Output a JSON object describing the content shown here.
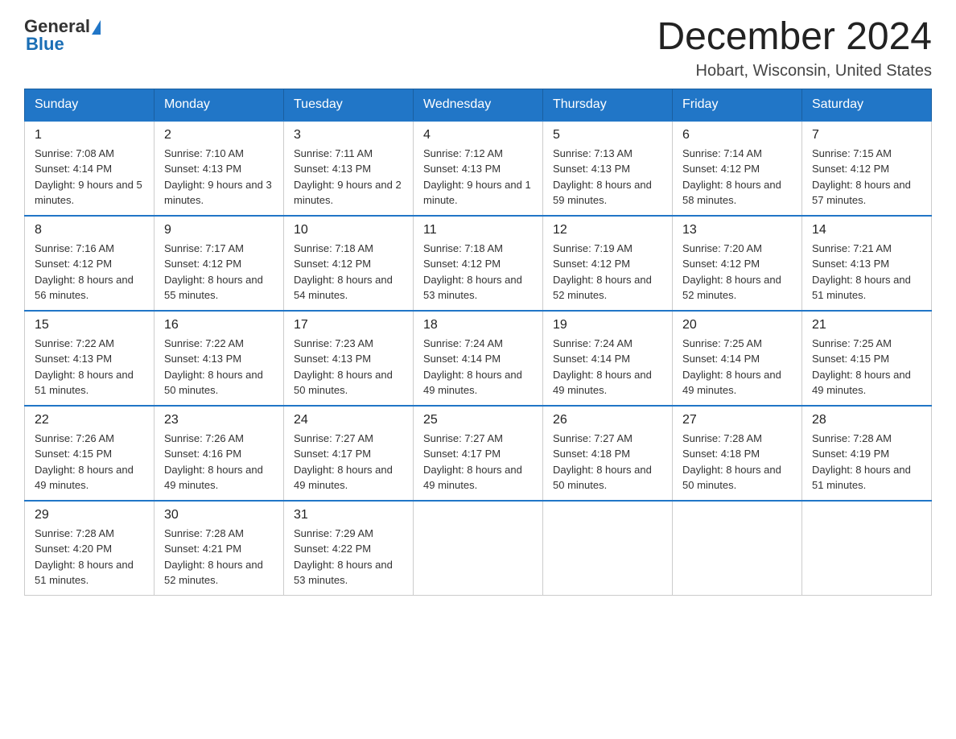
{
  "header": {
    "logo_general": "General",
    "logo_blue": "Blue",
    "month_title": "December 2024",
    "location": "Hobart, Wisconsin, United States"
  },
  "days_of_week": [
    "Sunday",
    "Monday",
    "Tuesday",
    "Wednesday",
    "Thursday",
    "Friday",
    "Saturday"
  ],
  "weeks": [
    [
      {
        "day": "1",
        "sunrise": "7:08 AM",
        "sunset": "4:14 PM",
        "daylight": "9 hours and 5 minutes."
      },
      {
        "day": "2",
        "sunrise": "7:10 AM",
        "sunset": "4:13 PM",
        "daylight": "9 hours and 3 minutes."
      },
      {
        "day": "3",
        "sunrise": "7:11 AM",
        "sunset": "4:13 PM",
        "daylight": "9 hours and 2 minutes."
      },
      {
        "day": "4",
        "sunrise": "7:12 AM",
        "sunset": "4:13 PM",
        "daylight": "9 hours and 1 minute."
      },
      {
        "day": "5",
        "sunrise": "7:13 AM",
        "sunset": "4:13 PM",
        "daylight": "8 hours and 59 minutes."
      },
      {
        "day": "6",
        "sunrise": "7:14 AM",
        "sunset": "4:12 PM",
        "daylight": "8 hours and 58 minutes."
      },
      {
        "day": "7",
        "sunrise": "7:15 AM",
        "sunset": "4:12 PM",
        "daylight": "8 hours and 57 minutes."
      }
    ],
    [
      {
        "day": "8",
        "sunrise": "7:16 AM",
        "sunset": "4:12 PM",
        "daylight": "8 hours and 56 minutes."
      },
      {
        "day": "9",
        "sunrise": "7:17 AM",
        "sunset": "4:12 PM",
        "daylight": "8 hours and 55 minutes."
      },
      {
        "day": "10",
        "sunrise": "7:18 AM",
        "sunset": "4:12 PM",
        "daylight": "8 hours and 54 minutes."
      },
      {
        "day": "11",
        "sunrise": "7:18 AM",
        "sunset": "4:12 PM",
        "daylight": "8 hours and 53 minutes."
      },
      {
        "day": "12",
        "sunrise": "7:19 AM",
        "sunset": "4:12 PM",
        "daylight": "8 hours and 52 minutes."
      },
      {
        "day": "13",
        "sunrise": "7:20 AM",
        "sunset": "4:12 PM",
        "daylight": "8 hours and 52 minutes."
      },
      {
        "day": "14",
        "sunrise": "7:21 AM",
        "sunset": "4:13 PM",
        "daylight": "8 hours and 51 minutes."
      }
    ],
    [
      {
        "day": "15",
        "sunrise": "7:22 AM",
        "sunset": "4:13 PM",
        "daylight": "8 hours and 51 minutes."
      },
      {
        "day": "16",
        "sunrise": "7:22 AM",
        "sunset": "4:13 PM",
        "daylight": "8 hours and 50 minutes."
      },
      {
        "day": "17",
        "sunrise": "7:23 AM",
        "sunset": "4:13 PM",
        "daylight": "8 hours and 50 minutes."
      },
      {
        "day": "18",
        "sunrise": "7:24 AM",
        "sunset": "4:14 PM",
        "daylight": "8 hours and 49 minutes."
      },
      {
        "day": "19",
        "sunrise": "7:24 AM",
        "sunset": "4:14 PM",
        "daylight": "8 hours and 49 minutes."
      },
      {
        "day": "20",
        "sunrise": "7:25 AM",
        "sunset": "4:14 PM",
        "daylight": "8 hours and 49 minutes."
      },
      {
        "day": "21",
        "sunrise": "7:25 AM",
        "sunset": "4:15 PM",
        "daylight": "8 hours and 49 minutes."
      }
    ],
    [
      {
        "day": "22",
        "sunrise": "7:26 AM",
        "sunset": "4:15 PM",
        "daylight": "8 hours and 49 minutes."
      },
      {
        "day": "23",
        "sunrise": "7:26 AM",
        "sunset": "4:16 PM",
        "daylight": "8 hours and 49 minutes."
      },
      {
        "day": "24",
        "sunrise": "7:27 AM",
        "sunset": "4:17 PM",
        "daylight": "8 hours and 49 minutes."
      },
      {
        "day": "25",
        "sunrise": "7:27 AM",
        "sunset": "4:17 PM",
        "daylight": "8 hours and 49 minutes."
      },
      {
        "day": "26",
        "sunrise": "7:27 AM",
        "sunset": "4:18 PM",
        "daylight": "8 hours and 50 minutes."
      },
      {
        "day": "27",
        "sunrise": "7:28 AM",
        "sunset": "4:18 PM",
        "daylight": "8 hours and 50 minutes."
      },
      {
        "day": "28",
        "sunrise": "7:28 AM",
        "sunset": "4:19 PM",
        "daylight": "8 hours and 51 minutes."
      }
    ],
    [
      {
        "day": "29",
        "sunrise": "7:28 AM",
        "sunset": "4:20 PM",
        "daylight": "8 hours and 51 minutes."
      },
      {
        "day": "30",
        "sunrise": "7:28 AM",
        "sunset": "4:21 PM",
        "daylight": "8 hours and 52 minutes."
      },
      {
        "day": "31",
        "sunrise": "7:29 AM",
        "sunset": "4:22 PM",
        "daylight": "8 hours and 53 minutes."
      },
      null,
      null,
      null,
      null
    ]
  ]
}
